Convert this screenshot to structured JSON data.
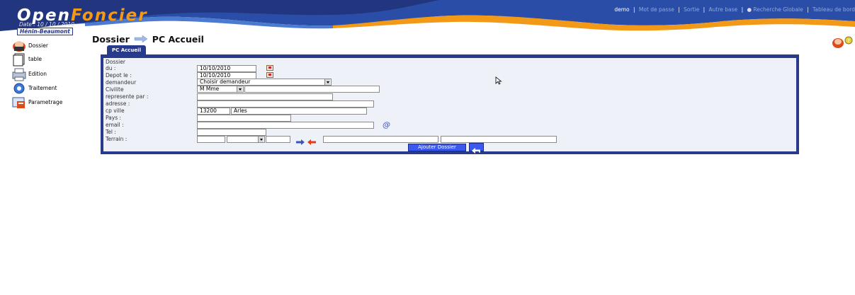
{
  "header": {
    "logo_open": "Open",
    "logo_foncier": "Foncier",
    "date": "Date : 10 / 10 / 2010",
    "commune": "Hénin-Beaumont",
    "user": "demo",
    "sep": "|",
    "menu": [
      "Mot de passe",
      "Sortie",
      "Autre base",
      "Recherche Globale",
      "Tableau de bord"
    ]
  },
  "sidebar": {
    "items": [
      {
        "label": "Dossier",
        "icon": "dossier-icon"
      },
      {
        "label": "table",
        "icon": "table-icon"
      },
      {
        "label": "Edition",
        "icon": "edition-icon"
      },
      {
        "label": "Traitement",
        "icon": "traitement-icon"
      },
      {
        "label": "Parametrage",
        "icon": "parametrage-icon"
      }
    ]
  },
  "breadcrumb": {
    "section": "Dossier",
    "page": "PC Accueil"
  },
  "tabs": [
    {
      "label": "PC Accueil",
      "active": true
    }
  ],
  "form": {
    "section_label": "Dossier",
    "du_label": "du :",
    "du_value": "10/10/2010",
    "depot_label": "Depot le :",
    "depot_value": "10/10/2010",
    "demandeur_label": "demandeur",
    "demandeur_value": "Choisir demandeur",
    "civilite_label": "Civilite",
    "civilite_value": "M Mme",
    "represente_label": "represente par :",
    "adresse_label": "adresse :",
    "cp_ville_label": "cp ville",
    "cp_value": "13200",
    "ville_value": "Arles",
    "pays_label": "Pays :",
    "email_label": "email :",
    "email_icon_text": "@",
    "tel_label": "Tel :",
    "terrain_label": "Terrain :",
    "submit_label": "Ajouter Dossier"
  },
  "colors": {
    "header_blue": "#283a8b",
    "header_orange": "#f29a17",
    "panel_blue": "#283a8b",
    "button_blue": "#3b59ee",
    "arrow_red": "#e23b1a",
    "arrow_blue": "#3a55b8"
  }
}
